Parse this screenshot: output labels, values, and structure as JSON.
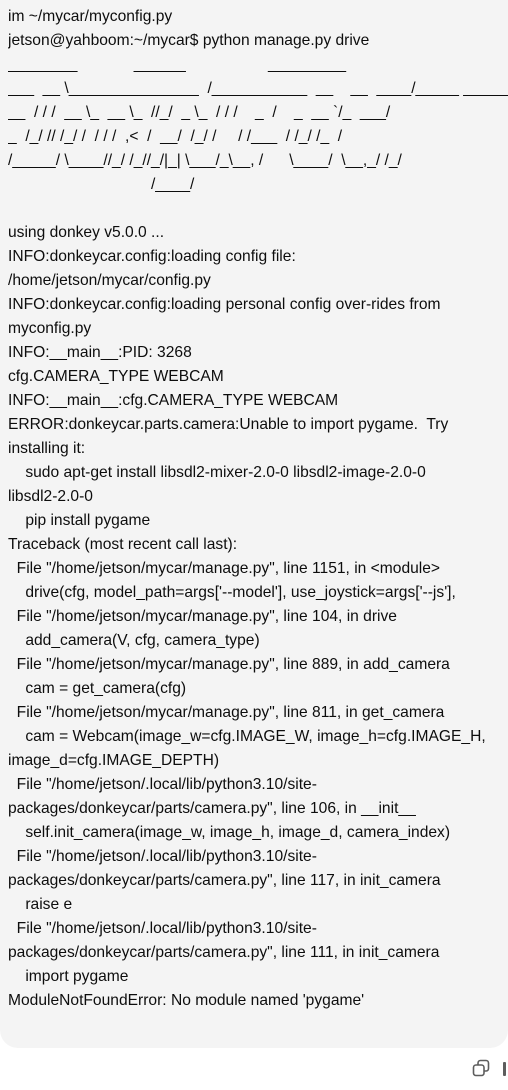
{
  "message": {
    "lines": [
      "im ~/mycar/myconfig.py",
      "jetson@yahboom:~/mycar$ python manage.py drive",
      "________             ______                   _________",
      "___  __ \\_______________  /___________  __    __  ____/_____ ________",
      "__  / / /  __ \\_  __ \\_  //_/  _ \\_  / / /    _  /    _  __ `/_  ___/",
      "_  /_/ // /_/ /  / / /  ,<  /  __/  /_/ /     / /___  / /_/ /_  /",
      "/_____/ \\____//_/ /_//_/|_| \\___/_\\__, /      \\____/  \\__,_/ /_/",
      "                                 /____/",
      "",
      "using donkey v5.0.0 ...",
      "INFO:donkeycar.config:loading config file:",
      "/home/jetson/mycar/config.py",
      "INFO:donkeycar.config:loading personal config over-rides from",
      "myconfig.py",
      "INFO:__main__:PID: 3268",
      "cfg.CAMERA_TYPE WEBCAM",
      "INFO:__main__:cfg.CAMERA_TYPE WEBCAM",
      "ERROR:donkeycar.parts.camera:Unable to import pygame.  Try",
      "installing it:",
      "    sudo apt-get install libsdl2-mixer-2.0-0 libsdl2-image-2.0-0",
      "libsdl2-2.0-0",
      "    pip install pygame",
      "Traceback (most recent call last):",
      "  File \"/home/jetson/mycar/manage.py\", line 1151, in <module>",
      "    drive(cfg, model_path=args['--model'], use_joystick=args['--js'],",
      "  File \"/home/jetson/mycar/manage.py\", line 104, in drive",
      "    add_camera(V, cfg, camera_type)",
      "  File \"/home/jetson/mycar/manage.py\", line 889, in add_camera",
      "    cam = get_camera(cfg)",
      "  File \"/home/jetson/mycar/manage.py\", line 811, in get_camera",
      "    cam = Webcam(image_w=cfg.IMAGE_W, image_h=cfg.IMAGE_H,",
      "image_d=cfg.IMAGE_DEPTH)",
      "  File \"/home/jetson/.local/lib/python3.10/site-",
      "packages/donkeycar/parts/camera.py\", line 106, in __init__",
      "    self.init_camera(image_w, image_h, image_d, camera_index)",
      "  File \"/home/jetson/.local/lib/python3.10/site-",
      "packages/donkeycar/parts/camera.py\", line 117, in init_camera",
      "    raise e",
      "  File \"/home/jetson/.local/lib/python3.10/site-",
      "packages/donkeycar/parts/camera.py\", line 111, in init_camera",
      "    import pygame",
      "ModuleNotFoundError: No module named 'pygame'"
    ]
  },
  "toolbar": {
    "copy_icon": "copy-icon"
  },
  "colors": {
    "bubble_bg": "#f4f4f4",
    "text": "#0d0d0d",
    "icon": "#5d5d5d"
  }
}
